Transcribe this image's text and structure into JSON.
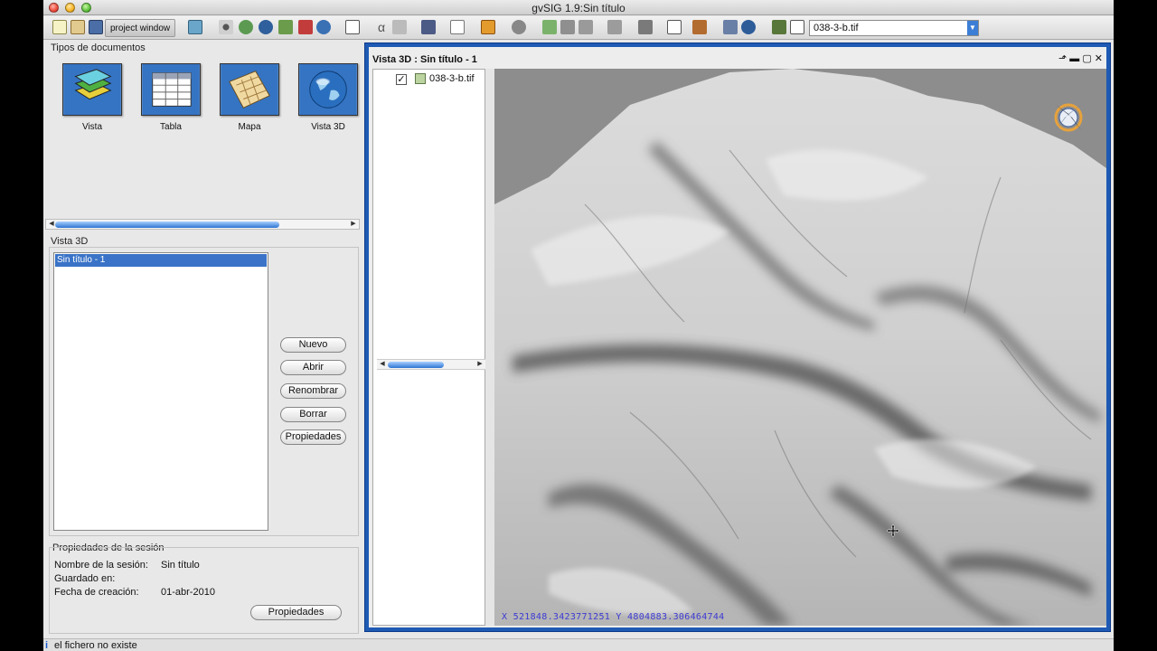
{
  "window": {
    "title": "gvSIG 1.9:Sin título"
  },
  "toolbar": {
    "project_window_label": "project window",
    "layer_selector": "038-3-b.tif",
    "icons": [
      "new-project-icon",
      "open-project-icon",
      "save-project-icon",
      "add-layer-icon",
      "pan-icon",
      "globe-pan-icon",
      "zoom-icon",
      "zoom-extent-icon",
      "remove-icon",
      "sphere-icon",
      "table-icon",
      "alpha-icon",
      "clear-icon",
      "monitor-icon",
      "fullscreen-icon",
      "export-icon",
      "circle-icon",
      "animation-icon",
      "settings-icon",
      "preferences-icon",
      "image-icon",
      "layout-icon",
      "tools-icon",
      "print-icon",
      "search-icon",
      "layers-icon"
    ]
  },
  "doc_types": {
    "title": "Tipos de documentos",
    "items": [
      {
        "label": "Vista",
        "icon": "vista-icon"
      },
      {
        "label": "Tabla",
        "icon": "tabla-icon"
      },
      {
        "label": "Mapa",
        "icon": "mapa-icon"
      },
      {
        "label": "Vista 3D",
        "icon": "vista-3d-icon"
      }
    ]
  },
  "vista3d": {
    "title": "Vista 3D",
    "items": [
      "Sin título - 1"
    ],
    "buttons": {
      "nuevo": "Nuevo",
      "abrir": "Abrir",
      "renombrar": "Renombrar",
      "borrar": "Borrar",
      "propiedades": "Propiedades"
    }
  },
  "session": {
    "title": "Propiedades de la sesión",
    "name_label": "Nombre de la sesión:",
    "name_value": "Sin título",
    "saved_label": "Guardado en:",
    "saved_value": "",
    "created_label": "Fecha de creación:",
    "created_value": "01-abr-2010",
    "button": "Propiedades"
  },
  "view": {
    "title": "Vista 3D : Sin título - 1",
    "layer": {
      "name": "038-3-b.tif",
      "checked": true
    },
    "coords": "X  521848.3423771251  Y   4804883.306464744"
  },
  "status": {
    "message": "el fichero no existe"
  },
  "colors": {
    "selection": "#3a73c7",
    "window_border": "#1e5ab4",
    "coord_text": "#3d3ad2"
  }
}
